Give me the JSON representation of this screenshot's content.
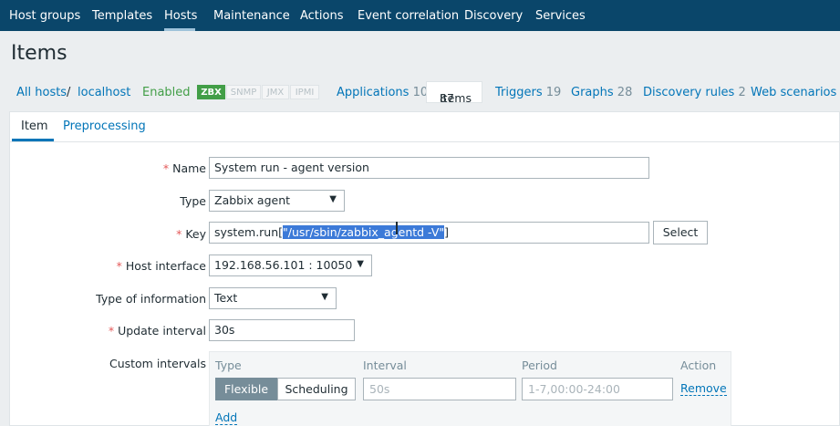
{
  "topnav": {
    "items": [
      "Host groups",
      "Templates",
      "Hosts",
      "Maintenance",
      "Actions",
      "Event correlation",
      "Discovery",
      "Services"
    ],
    "active": "Hosts"
  },
  "page": {
    "title": "Items"
  },
  "breadcrumbs": {
    "all_hosts": "All hosts",
    "separator": "/",
    "host": "localhost",
    "status": "Enabled",
    "availability": [
      "ZBX",
      "SNMP",
      "JMX",
      "IPMI"
    ],
    "tabs": [
      {
        "label": "Applications",
        "count": "10"
      },
      {
        "label": "Items",
        "count": "87"
      },
      {
        "label": "Triggers",
        "count": "19"
      },
      {
        "label": "Graphs",
        "count": "28"
      },
      {
        "label": "Discovery rules",
        "count": "2"
      },
      {
        "label": "Web scenarios",
        "count": ""
      }
    ]
  },
  "subtabs": [
    "Item",
    "Preprocessing"
  ],
  "form": {
    "required_mark": "*",
    "name": {
      "label": "Name",
      "value": "System run - agent version"
    },
    "type": {
      "label": "Type",
      "value": "Zabbix agent"
    },
    "key": {
      "label": "Key",
      "value_prefix": "system.run[",
      "value_selected": "\"/usr/sbin/zabbix_agentd -V\"",
      "value_suffix": "]",
      "select_button": "Select"
    },
    "host_interface": {
      "label": "Host interface",
      "value": "192.168.56.101 : 10050"
    },
    "type_of_information": {
      "label": "Type of information",
      "value": "Text"
    },
    "update_interval": {
      "label": "Update interval",
      "value": "30s"
    },
    "custom_intervals": {
      "label": "Custom intervals",
      "columns": [
        "Type",
        "Interval",
        "Period",
        "Action"
      ],
      "row": {
        "type_options": [
          "Flexible",
          "Scheduling"
        ],
        "type_selected": "Flexible",
        "interval_placeholder": "50s",
        "period_placeholder": "1-7,00:00-24:00",
        "action": "Remove"
      },
      "add_link": "Add"
    }
  },
  "colors": {
    "nav_bg": "#0a466a",
    "link": "#0275b8",
    "enabled": "#429e47",
    "required": "#e45959",
    "selection": "#3c7ad8"
  }
}
